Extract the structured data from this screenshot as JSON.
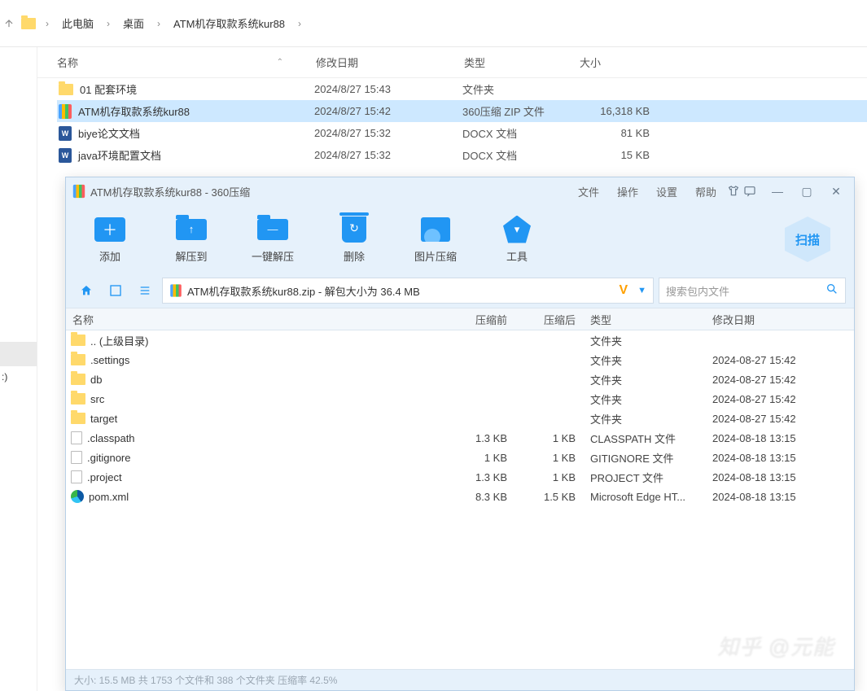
{
  "explorer": {
    "breadcrumb": [
      "此电脑",
      "桌面",
      "ATM机存取款系统kur88"
    ],
    "columns": {
      "name": "名称",
      "date": "修改日期",
      "type": "类型",
      "size": "大小"
    },
    "drive_label": ":)",
    "rows": [
      {
        "icon": "folder",
        "name": "01 配套环境",
        "date": "2024/8/27 15:43",
        "type": "文件夹",
        "size": "",
        "selected": false
      },
      {
        "icon": "zip",
        "name": "ATM机存取款系统kur88",
        "date": "2024/8/27 15:42",
        "type": "360压缩 ZIP 文件",
        "size": "16,318 KB",
        "selected": true
      },
      {
        "icon": "docx",
        "name": "biye论文文档",
        "date": "2024/8/27 15:32",
        "type": "DOCX 文档",
        "size": "81 KB",
        "selected": false
      },
      {
        "icon": "docx",
        "name": "java环境配置文档",
        "date": "2024/8/27 15:32",
        "type": "DOCX 文档",
        "size": "15 KB",
        "selected": false
      }
    ]
  },
  "zip": {
    "title": "ATM机存取款系统kur88 - 360压缩",
    "menus": [
      "文件",
      "操作",
      "设置",
      "帮助"
    ],
    "scan_label": "扫描",
    "toolbar": [
      {
        "id": "add",
        "label": "添加"
      },
      {
        "id": "extract-to",
        "label": "解压到"
      },
      {
        "id": "one-click",
        "label": "一键解压"
      },
      {
        "id": "delete",
        "label": "删除"
      },
      {
        "id": "img-compress",
        "label": "图片压缩"
      },
      {
        "id": "tools",
        "label": "工具"
      }
    ],
    "path_text": "ATM机存取款系统kur88.zip - 解包大小为 36.4 MB",
    "search_placeholder": "搜索包内文件",
    "headers": {
      "name": "名称",
      "pre": "压缩前",
      "post": "压缩后",
      "type": "类型",
      "date": "修改日期"
    },
    "rows": [
      {
        "icon": "folder",
        "name": ".. (上级目录)",
        "pre": "",
        "post": "",
        "type": "文件夹",
        "date": ""
      },
      {
        "icon": "folder",
        "name": ".settings",
        "pre": "",
        "post": "",
        "type": "文件夹",
        "date": "2024-08-27 15:42"
      },
      {
        "icon": "folder",
        "name": "db",
        "pre": "",
        "post": "",
        "type": "文件夹",
        "date": "2024-08-27 15:42"
      },
      {
        "icon": "folder",
        "name": "src",
        "pre": "",
        "post": "",
        "type": "文件夹",
        "date": "2024-08-27 15:42"
      },
      {
        "icon": "folder",
        "name": "target",
        "pre": "",
        "post": "",
        "type": "文件夹",
        "date": "2024-08-27 15:42"
      },
      {
        "icon": "file",
        "name": ".classpath",
        "pre": "1.3 KB",
        "post": "1 KB",
        "type": "CLASSPATH 文件",
        "date": "2024-08-18 13:15"
      },
      {
        "icon": "file",
        "name": ".gitignore",
        "pre": "1 KB",
        "post": "1 KB",
        "type": "GITIGNORE 文件",
        "date": "2024-08-18 13:15"
      },
      {
        "icon": "file",
        "name": ".project",
        "pre": "1.3 KB",
        "post": "1 KB",
        "type": "PROJECT 文件",
        "date": "2024-08-18 13:15"
      },
      {
        "icon": "edge",
        "name": "pom.xml",
        "pre": "8.3 KB",
        "post": "1.5 KB",
        "type": "Microsoft Edge HT...",
        "date": "2024-08-18 13:15"
      }
    ],
    "status": "大小: 15.5 MB 共 1753 个文件和 388 个文件夹 压缩率 42.5%"
  },
  "watermark": "知乎 @元能"
}
